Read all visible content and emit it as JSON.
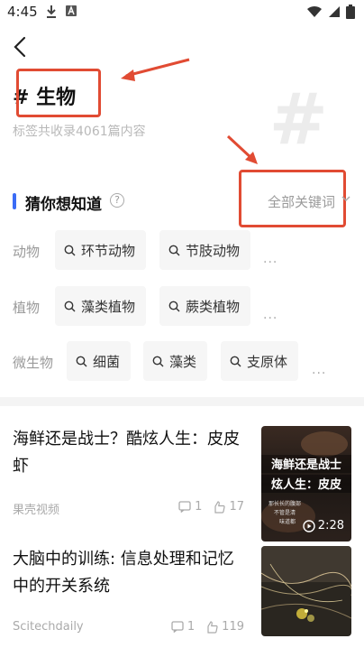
{
  "status": {
    "time": "4:45",
    "left_icons": [
      "download-icon",
      "app-icon"
    ],
    "right_icons": [
      "wifi-icon",
      "signal-icon",
      "battery-icon"
    ]
  },
  "header": {
    "back_icon": "chevron-left-icon"
  },
  "topic": {
    "hash": "#",
    "title": "# 生物",
    "subtitle": "标签共收录4061篇内容"
  },
  "guess": {
    "title": "猜你想知道",
    "help_icon": "question-circle-icon",
    "all_keywords": "全部关键词"
  },
  "keyword_rows": [
    {
      "category": "动物",
      "chips": [
        "环节动物",
        "节肢动物"
      ]
    },
    {
      "category": "植物",
      "chips": [
        "藻类植物",
        "蕨类植物"
      ]
    },
    {
      "category": "微生物",
      "chips": [
        "细菌",
        "藻类",
        "支原体"
      ]
    }
  ],
  "more_glyph": "···",
  "articles": [
    {
      "title": "海鲜还是战士？酷炫人生：皮皮虾",
      "source": "果壳视频",
      "comments": "1",
      "likes": "17",
      "thumb_caption_lines": [
        "海鲜还是战士",
        "炫人生：皮皮"
      ],
      "thumb_small_text": [
        "那长长的腹部",
        "不管是清",
        "味道都"
      ],
      "video_duration": "2:28"
    },
    {
      "title": "大脑中的训练: 信息处理和记忆中的开关系统",
      "source": "Scitechdaily",
      "comments": "1",
      "likes": "119"
    }
  ],
  "colors": {
    "accent": "#3b6cf6",
    "annotation": "#e14b33"
  }
}
